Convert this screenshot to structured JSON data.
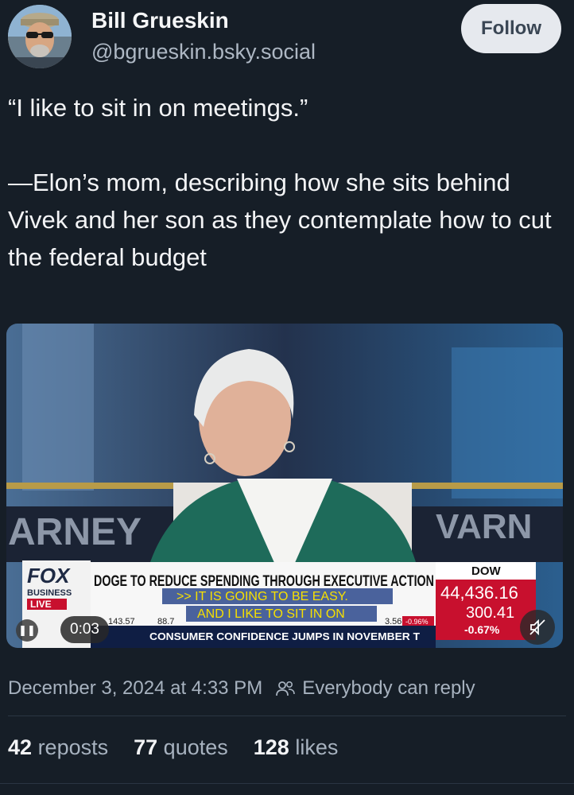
{
  "author": {
    "name": "Bill Grueskin",
    "handle": "@bgrueskin.bsky.social",
    "follow_label": "Follow"
  },
  "post": {
    "line1": "“I like to sit in on meetings.”",
    "line2": "—Elon’s mom, describing how she sits behind Vivek and her son as they contemplate how to cut the federal budget"
  },
  "video": {
    "time": "0:03",
    "icons": {
      "play": "pause-icon",
      "mute": "mute-icon"
    },
    "broadcast": {
      "network": "FOX",
      "network_sub": "BUSINESS",
      "live": "LIVE",
      "headline": "DOGE TO REDUCE SPENDING THROUGH EXECUTIVE ACTION",
      "caption1": ">> IT IS GOING TO BE EASY.",
      "caption2": "AND I LIKE TO SIT IN ON",
      "ticker": "CONSUMER CONFIDENCE JUMPS IN NOVEMBER T",
      "ticker_left": "143.57",
      "ticker_mid": "88.7",
      "ticker_right": "3.56",
      "ticker_pct": "-0.96%",
      "backdrop_left": "ARNEY",
      "backdrop_right": "VARN",
      "dow_label": "DOW",
      "dow_value": "44,436.16",
      "dow_change": "300.41",
      "dow_pct": "-0.67%"
    }
  },
  "meta": {
    "timestamp": "December 3, 2024 at 4:33 PM",
    "reply_setting": "Everybody can reply"
  },
  "stats": {
    "reposts_count": "42",
    "reposts_label": "reposts",
    "quotes_count": "77",
    "quotes_label": "quotes",
    "likes_count": "128",
    "likes_label": "likes"
  },
  "colors": {
    "background": "#161e27",
    "follow_bg": "#e6e9ee",
    "muted_text": "#a7b2bf",
    "fox_red": "#c8102e"
  }
}
